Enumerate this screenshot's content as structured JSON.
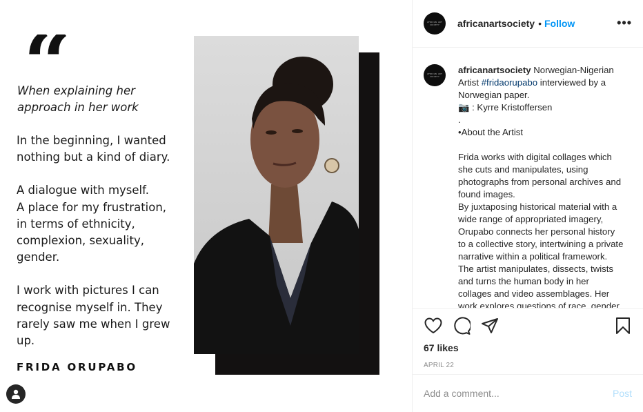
{
  "post_image": {
    "quote_mark": "“",
    "quote_intro": "When explaining her\napproach in her work",
    "quote_paragraphs": [
      "In the beginning, I wanted\nnothing but a kind of diary.",
      "A dialogue with myself.\nA place for my frustration,\nin terms of ethnicity,\ncomplexion, sexuality,\ngender.",
      "I work with pictures I can\nrecognise myself in. They\nrarely saw me when I grew\nup."
    ],
    "author": "FRIDA ORUPABO",
    "user_tag_icon": "person-icon"
  },
  "header": {
    "avatar_text": "AFRICAN ART SOCIETY",
    "username": "africanartsociety",
    "separator": "•",
    "follow_label": "Follow",
    "more_label": "•••"
  },
  "caption": {
    "username": "africanartsociety",
    "text_before_tag": " Norwegian-Nigerian Artist ",
    "hashtag": "#fridaorupabo",
    "text_after_tag": " interviewed by a Norwegian paper.\n📷 : Kyrre Kristoffersen\n.\n•About the Artist\n\nFrida works with digital collages which she cuts and manipulates, using photographs from personal archives and found images.\nBy juxtaposing historical material with a wide range of appropriated imagery, Orupabo connects her personal history to a collective story, intertwining a private narrative within a political framework.\nThe artist manipulates, dissects, twists and turns the human body in her collages and video assemblages. Her work explores questions of race, gender, sexuality and identity."
  },
  "actions": {
    "icons": [
      "heart-icon",
      "comment-icon",
      "share-icon",
      "bookmark-icon"
    ],
    "likes": "67 likes",
    "date": "APRIL 22"
  },
  "comment": {
    "placeholder": "Add a comment...",
    "post_label": "Post"
  },
  "colors": {
    "follow_blue": "#0095f6",
    "hashtag_blue": "#00376b",
    "post_disabled": "#b2dffc",
    "muted_gray": "#8e8e8e"
  }
}
